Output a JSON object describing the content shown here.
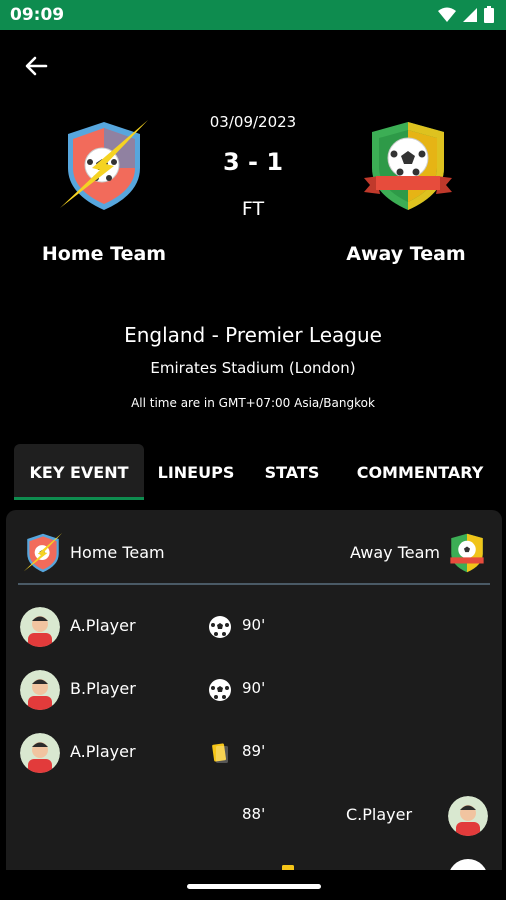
{
  "status_bar": {
    "time": "09:09",
    "bg_color": "#0e8c4f"
  },
  "header": {
    "back_icon": "arrow-left-icon",
    "date": "03/09/2023",
    "score": "3 - 1",
    "status": "FT",
    "home_team": "Home Team",
    "away_team": "Away Team",
    "league": "England - Premier League",
    "stadium": "Emirates Stadium (London)",
    "timezone": "All time are in GMT+07:00 Asia/Bangkok"
  },
  "tabs": [
    {
      "label": "KEY EVENT",
      "active": true
    },
    {
      "label": "LINEUPS",
      "active": false
    },
    {
      "label": "STATS",
      "active": false
    },
    {
      "label": "COMMENTARY",
      "active": false
    }
  ],
  "events": {
    "home_team": "Home Team",
    "away_team": "Away Team",
    "rows": [
      {
        "player": "A.Player",
        "side": "home",
        "type": "goal",
        "minute": "90'"
      },
      {
        "player": "B.Player",
        "side": "home",
        "type": "goal",
        "minute": "90'"
      },
      {
        "player": "A.Player",
        "side": "home",
        "type": "yellow-card",
        "minute": "89'"
      },
      {
        "player": "C.Player",
        "side": "away",
        "type": "none",
        "minute": "88'"
      }
    ]
  },
  "colors": {
    "accent": "#0e8c4f",
    "panel": "#1c1c1c",
    "yellow_card": "#f5c518"
  }
}
